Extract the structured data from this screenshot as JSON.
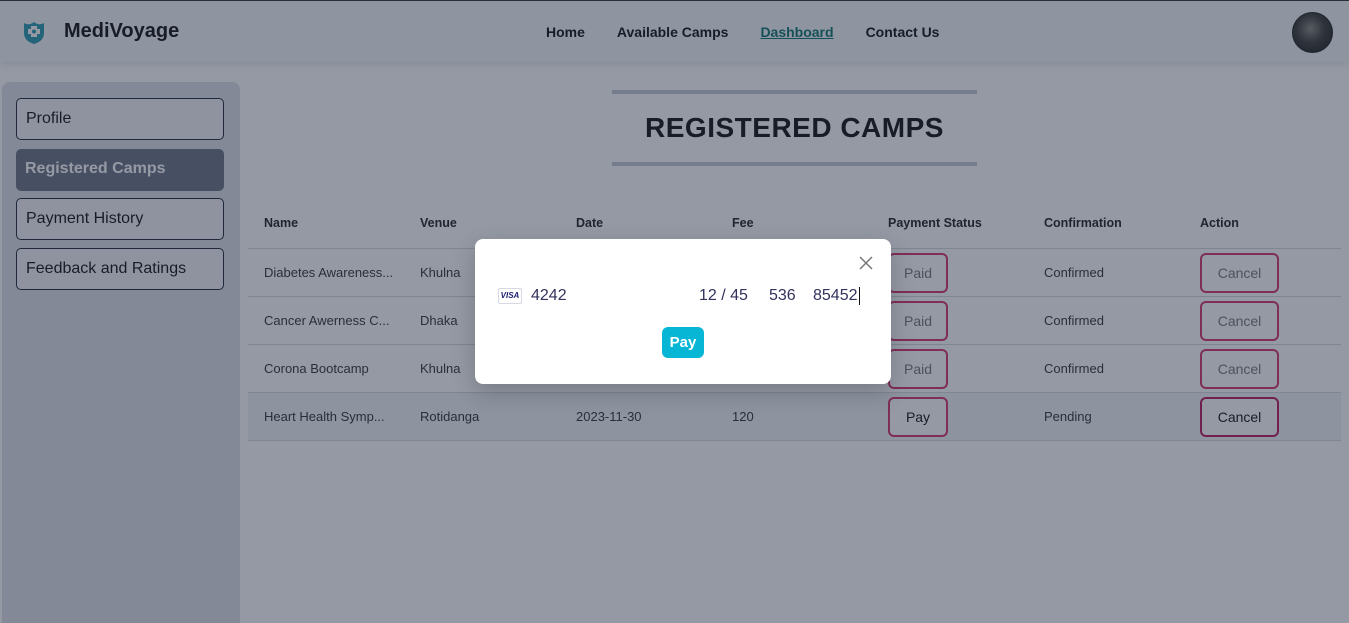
{
  "navbar": {
    "brand": "MediVoyage",
    "links": [
      {
        "label": "Home"
      },
      {
        "label": "Available Camps"
      },
      {
        "label": "Dashboard",
        "active": true
      },
      {
        "label": "Contact Us"
      }
    ]
  },
  "sidebar": {
    "items": [
      {
        "label": "Profile"
      },
      {
        "label": "Registered Camps",
        "active": true
      },
      {
        "label": "Payment History"
      },
      {
        "label": "Feedback and Ratings"
      }
    ]
  },
  "main": {
    "title": "REGISTERED CAMPS",
    "table": {
      "headers": [
        "Name",
        "Venue",
        "Date",
        "Fee",
        "Payment Status",
        "Confirmation",
        "Action"
      ],
      "rows": [
        {
          "name": "Diabetes Awareness...",
          "venue": "Khulna",
          "date": "",
          "fee": "",
          "payment": "Paid",
          "confirmation": "Confirmed",
          "action": "Cancel"
        },
        {
          "name": "Cancer Awerness C...",
          "venue": "Dhaka",
          "date": "",
          "fee": "",
          "payment": "Paid",
          "confirmation": "Confirmed",
          "action": "Cancel"
        },
        {
          "name": "Corona Bootcamp",
          "venue": "Khulna",
          "date": "",
          "fee": "",
          "payment": "Paid",
          "confirmation": "Confirmed",
          "action": "Cancel"
        },
        {
          "name": "Heart Health Symp...",
          "venue": "Rotidanga",
          "date": "2023-11-30",
          "fee": "120",
          "payment": "Pay",
          "confirmation": "Pending",
          "action": "Cancel"
        }
      ]
    }
  },
  "modal": {
    "card_brand": "VISA",
    "card_number": "4242",
    "expiry": "12 / 45",
    "cvc": "536",
    "zip": "85452",
    "pay_label": "Pay"
  },
  "colors": {
    "accent": "#06b6d4",
    "active_link": "#0f766e",
    "danger_border": "#d6336c"
  }
}
